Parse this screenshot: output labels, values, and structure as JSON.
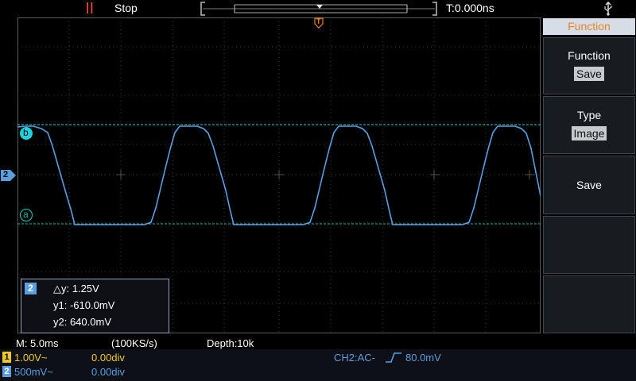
{
  "topbar": {
    "run_indicator": "||",
    "run_state": "Stop",
    "trigger_time": "T:0.000ns"
  },
  "menu": {
    "title": "Function",
    "items": [
      {
        "label": "Function",
        "value": "Save"
      },
      {
        "label": "Type",
        "value": "Image"
      },
      {
        "label": "Save",
        "value": ""
      }
    ]
  },
  "markers": {
    "trigger_marker": "T",
    "channel2_marker": "2",
    "cursor_b": "b",
    "cursor_a": "a"
  },
  "cursor_readout": {
    "channel": "2",
    "delta_y": "△y: 1.25V",
    "y1": "y1: -610.0mV",
    "y2": "y2: 640.0mV"
  },
  "status": {
    "timebase": "M: 5.0ms",
    "sample_rate": "(100KS/s)",
    "depth": "Depth:10k"
  },
  "channels": [
    {
      "id": "1",
      "scale": "1.00V~",
      "offset": "0.00div",
      "color": "#f0c82c"
    },
    {
      "id": "2",
      "scale": "500mV~",
      "offset": "0.00div",
      "color": "#5a9ee0"
    }
  ],
  "trigger": {
    "source_coupling": "CH2:AC-",
    "level": "80.0mV"
  },
  "colors": {
    "waveform": "#5a9ee0",
    "cursor_b": "#1fd3e0",
    "cursor_a": "#19b3a8",
    "trigger_marker": "#e8832a",
    "run_indicator": "#e0413a"
  }
}
